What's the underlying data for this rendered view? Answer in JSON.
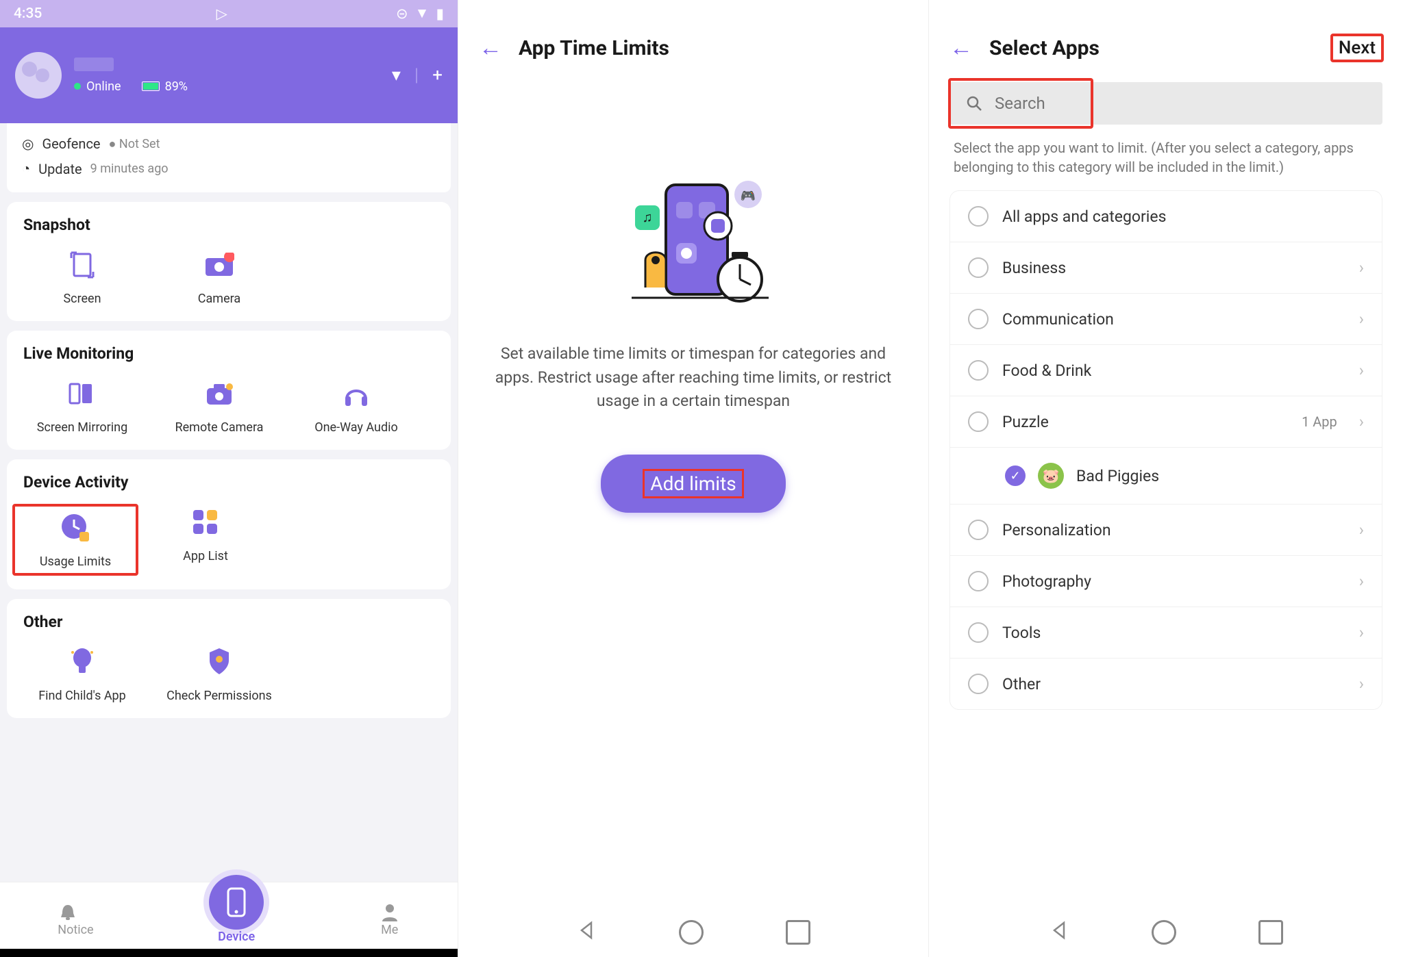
{
  "panel1": {
    "status_time": "4:35",
    "online_label": "Online",
    "battery_pct": "89%",
    "geofence_label": "Geofence",
    "geofence_status": "Not Set",
    "update_label": "Update",
    "update_time": "9 minutes ago",
    "sections": {
      "snapshot": {
        "title": "Snapshot",
        "items": [
          "Screen",
          "Camera"
        ]
      },
      "live": {
        "title": "Live Monitoring",
        "items": [
          "Screen Mirroring",
          "Remote Camera",
          "One-Way Audio"
        ]
      },
      "activity": {
        "title": "Device Activity",
        "items": [
          "Usage Limits",
          "App List"
        ]
      },
      "other": {
        "title": "Other",
        "items": [
          "Find Child's App",
          "Check Permissions"
        ]
      }
    },
    "nav": {
      "notice": "Notice",
      "device": "Device",
      "me": "Me"
    }
  },
  "panel2": {
    "title": "App Time Limits",
    "description": "Set available time limits or timespan for categories and apps. Restrict usage after reaching time limits, or restrict usage in a certain timespan",
    "button": "Add limits"
  },
  "panel3": {
    "title": "Select Apps",
    "next": "Next",
    "search_placeholder": "Search",
    "hint": "Select the app you want to limit. (After you select a category, apps belonging to this category will be included in the limit.)",
    "rows": [
      {
        "label": "All apps and categories"
      },
      {
        "label": "Business"
      },
      {
        "label": "Communication"
      },
      {
        "label": "Food & Drink"
      },
      {
        "label": "Puzzle",
        "meta": "1 App",
        "sub": {
          "app": "Bad Piggies"
        }
      },
      {
        "label": "Personalization"
      },
      {
        "label": "Photography"
      },
      {
        "label": "Tools"
      },
      {
        "label": "Other"
      }
    ]
  }
}
